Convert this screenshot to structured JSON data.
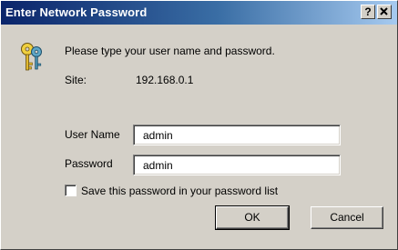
{
  "window": {
    "title": "Enter Network Password",
    "help_label": "?",
    "close_label": "X"
  },
  "dialog": {
    "prompt": "Please type your user name and password.",
    "site_label": "Site:",
    "site_value": "192.168.0.1",
    "username_label": "User Name",
    "username_value": "admin",
    "password_label": "Password",
    "password_value": "admin",
    "save_password_label": "Save this password in your password list",
    "save_password_checked": false,
    "ok_label": "OK",
    "cancel_label": "Cancel"
  },
  "icons": {
    "dialog_icon": "keys-icon"
  },
  "colors": {
    "title_gradient_start": "#0a246a",
    "title_gradient_end": "#a6caf0",
    "dialog_background": "#d4d0c8"
  }
}
